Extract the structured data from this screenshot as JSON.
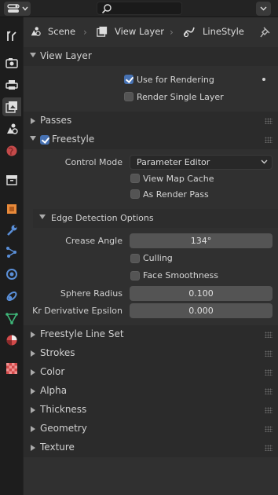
{
  "header": {
    "editor_type_icon": "properties-editor-icon",
    "search_placeholder": "",
    "right_dropdown_icon": "chevron-down-icon"
  },
  "tabs": [
    {
      "name": "tool",
      "icon": "tool-icon"
    },
    {
      "name": "render",
      "icon": "camera-back-icon"
    },
    {
      "name": "output",
      "icon": "printer-icon"
    },
    {
      "name": "view-layer",
      "icon": "image-stack-icon",
      "active": true
    },
    {
      "name": "scene",
      "icon": "scene-icon"
    },
    {
      "name": "world",
      "icon": "world-icon"
    },
    {
      "name": "collection",
      "icon": "collection-box-icon"
    },
    {
      "name": "object",
      "icon": "object-icon"
    },
    {
      "name": "modifiers",
      "icon": "wrench-icon"
    },
    {
      "name": "particles",
      "icon": "particles-icon"
    },
    {
      "name": "physics",
      "icon": "physics-icon"
    },
    {
      "name": "constraints",
      "icon": "constraints-icon"
    },
    {
      "name": "object-data",
      "icon": "object-data-icon"
    },
    {
      "name": "material",
      "icon": "material-icon"
    },
    {
      "name": "texture",
      "icon": "checker-texture-icon"
    }
  ],
  "breadcrumbs": [
    "Scene",
    "View Layer",
    "LineStyle"
  ],
  "view_layer": {
    "title": "View Layer",
    "use_for_rendering": {
      "label": "Use for Rendering",
      "checked": true
    },
    "render_single_layer": {
      "label": "Render Single Layer",
      "checked": false
    }
  },
  "passes": {
    "title": "Passes"
  },
  "freestyle": {
    "title": "Freestyle",
    "checked": true,
    "control_mode_label": "Control Mode",
    "control_mode_value": "Parameter Editor",
    "view_map_cache": {
      "label": "View Map Cache",
      "checked": false
    },
    "as_render_pass": {
      "label": "As Render Pass",
      "checked": false
    },
    "edge_detection": {
      "title": "Edge Detection Options",
      "crease_angle_label": "Crease Angle",
      "crease_angle_value": "134°",
      "culling": {
        "label": "Culling",
        "checked": false
      },
      "face_smoothness": {
        "label": "Face Smoothness",
        "checked": false
      },
      "sphere_radius_label": "Sphere Radius",
      "sphere_radius_value": "0.100",
      "kr_epsilon_label": "Kr Derivative Epsilon",
      "kr_epsilon_value": "0.000"
    }
  },
  "collapsed_panels": [
    "Freestyle Line Set",
    "Strokes",
    "Color",
    "Alpha",
    "Thickness",
    "Geometry",
    "Texture"
  ],
  "colors": {
    "accent": "#4772b3",
    "panel_bg": "#303030",
    "header_bg": "#2b2b2b"
  }
}
